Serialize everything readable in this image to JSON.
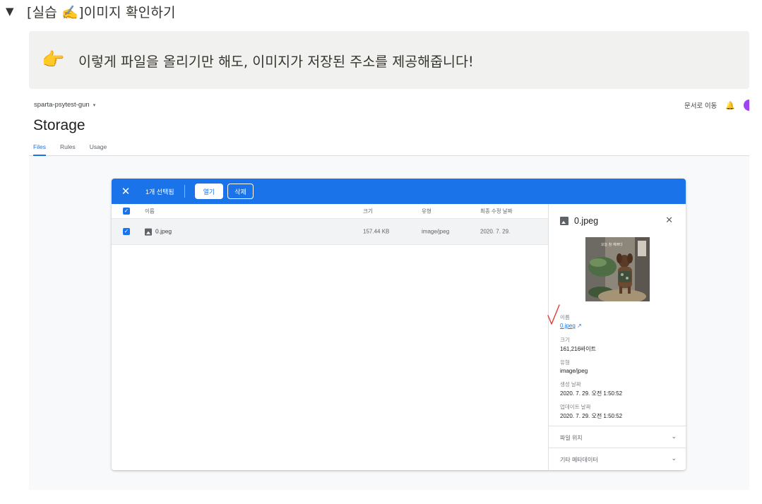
{
  "toggle": {
    "arrow": "▼",
    "title": "[실습 ✍️]이미지 확인하기"
  },
  "callout": {
    "icon": "👉",
    "text": "이렇게 파일을 올리기만 해도, 이미지가 저장된 주소를 제공해줍니다!"
  },
  "firebase": {
    "project": "sparta-psytest-gun",
    "project_caret": "▾",
    "docs_link": "문서로 이동",
    "bell_icon": "🔔",
    "title": "Storage",
    "tabs": [
      {
        "label": "Files",
        "active": true
      },
      {
        "label": "Rules",
        "active": false
      },
      {
        "label": "Usage",
        "active": false
      }
    ],
    "selection_bar": {
      "close": "✕",
      "count": "1개 선택됨",
      "open": "열기",
      "delete": "삭제"
    },
    "table": {
      "headers": {
        "name": "이름",
        "size": "크기",
        "type": "유형",
        "modified": "최종 수정 날짜"
      },
      "rows": [
        {
          "name": "0.jpeg",
          "size": "157.44 KB",
          "type": "image/jpeg",
          "modified": "2020. 7. 29."
        }
      ]
    },
    "details": {
      "filename": "0.jpeg",
      "close": "✕",
      "thumb_caption": "오늘 참 예쁘다",
      "fields": [
        {
          "label": "이름",
          "value": "0.jpeg"
        },
        {
          "label": "크기",
          "value": "161,216바이트"
        },
        {
          "label": "유형",
          "value": "image/jpeg"
        },
        {
          "label": "생성 날짜",
          "value": "2020. 7. 29. 오전 1:50:52"
        },
        {
          "label": "업데이트 날짜",
          "value": "2020. 7. 29. 오전 1:50:52"
        }
      ],
      "accordions": [
        {
          "label": "파일 위치"
        },
        {
          "label": "기타 메타데이터"
        }
      ]
    },
    "colors": {
      "accent": "#1a73e8",
      "annotation": "#e53935"
    }
  }
}
